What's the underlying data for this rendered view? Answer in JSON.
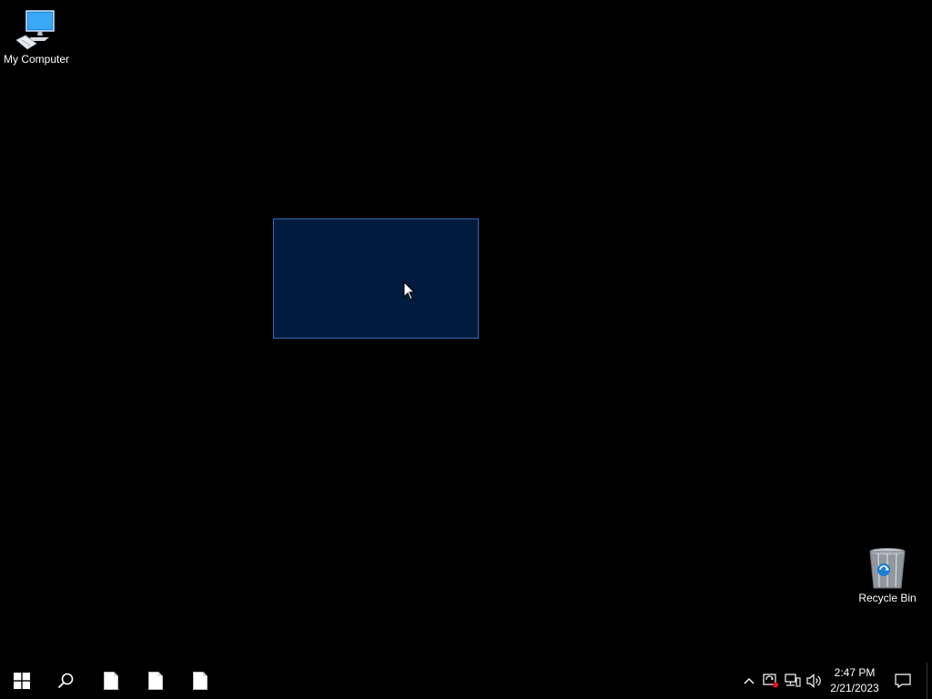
{
  "desktop": {
    "icons": [
      {
        "label": "My Computer",
        "icon": "computer-icon"
      },
      {
        "label": "Recycle Bin",
        "icon": "recycle-bin-icon"
      }
    ],
    "selection": {
      "color": "#001b3d",
      "border": "#2f6fb8"
    }
  },
  "taskbar": {
    "start_icon": "windows-logo-icon",
    "search_icon": "search-icon",
    "pinned_apps": [
      {
        "icon": "blank-document-icon"
      },
      {
        "icon": "blank-document-icon"
      },
      {
        "icon": "blank-document-icon"
      }
    ],
    "tray": {
      "icons": [
        "chevron-up-icon",
        "security-alert-icon",
        "network-icon",
        "volume-icon"
      ],
      "time": "2:47 PM",
      "date": "2/21/2023",
      "notification_icon": "action-center-icon"
    }
  },
  "colors": {
    "background": "#000000",
    "accent": "#2f6fb8",
    "taskbar": "#000000",
    "text": "#ffffff"
  }
}
